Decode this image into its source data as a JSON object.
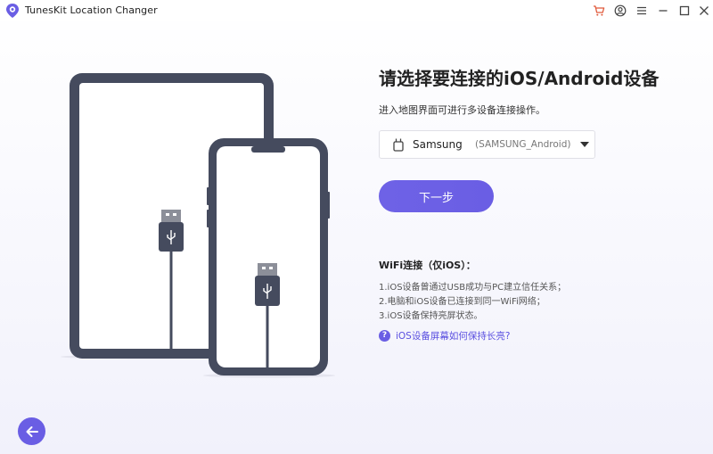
{
  "window": {
    "title": "TunesKit Location Changer",
    "accent": "#6a5ee4"
  },
  "titlebar": {
    "icons": [
      "cart-icon",
      "account-icon",
      "menu-icon",
      "minimize-icon",
      "maximize-icon",
      "close-icon"
    ]
  },
  "main": {
    "heading": "请选择要连接的iOS/Android设备",
    "subtext": "进入地图界面可进行多设备连接操作。",
    "device_select": {
      "name": "Samsung",
      "id": "(SAMSUNG_Android)"
    },
    "next_label": "下一步",
    "wifi": {
      "title": "WiFi连接（仅iOS）：",
      "steps": [
        "1.iOS设备曾通过USB成功与PC建立信任关系；",
        "2.电脑和iOS设备已连接到同一WiFi网络；",
        "3.iOS设备保持亮屏状态。"
      ]
    },
    "help_link": "iOS设备屏幕如何保持长亮?",
    "help_icon_glyph": "?"
  }
}
